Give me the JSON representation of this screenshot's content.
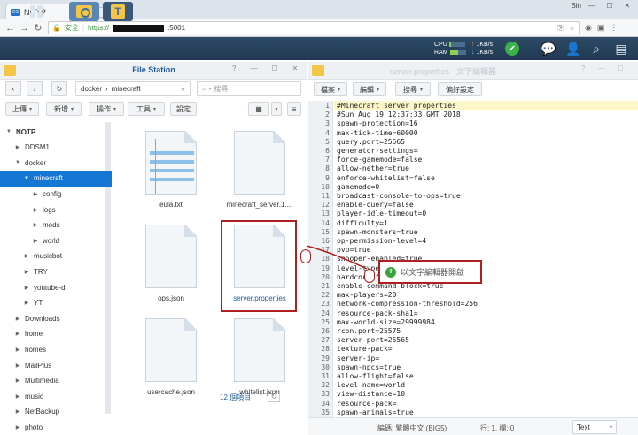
{
  "browser": {
    "tab_title": "NOTP",
    "tab_favicon": "synology-favicon",
    "url_secure_label": "安全",
    "url_prefix": "https://",
    "url_suffix": ":5001",
    "user_corner": "Bin"
  },
  "dsm": {
    "cpu_label": "CPU",
    "ram_label": "RAM",
    "cpu_fraction": 0.15,
    "ram_fraction": 0.5,
    "net_up": "1KB/s",
    "net_down": "1KB/s",
    "net_up_arrow": "↑",
    "net_down_arrow": "↓"
  },
  "filestation": {
    "title": "File Station",
    "path_root": "docker",
    "path_sep": "›",
    "path_leaf": "minecraft",
    "search_placeholder": "搜尋",
    "toolbar": {
      "upload": "上傳",
      "new": "新增",
      "action": "操作",
      "tools": "工具",
      "settings": "設定"
    },
    "tree": [
      {
        "label": "NOTP",
        "arrow": "▼",
        "level": 0,
        "bold": true
      },
      {
        "label": "DDSM1",
        "arrow": "▶",
        "level": 1
      },
      {
        "label": "docker",
        "arrow": "▼",
        "level": 1
      },
      {
        "label": "minecraft",
        "arrow": "▼",
        "level": 2,
        "selected": true
      },
      {
        "label": "config",
        "arrow": "▶",
        "level": 3
      },
      {
        "label": "logs",
        "arrow": "▶",
        "level": 3
      },
      {
        "label": "mods",
        "arrow": "▶",
        "level": 3
      },
      {
        "label": "world",
        "arrow": "▶",
        "level": 3
      },
      {
        "label": "musicbot",
        "arrow": "▶",
        "level": 2
      },
      {
        "label": "TRY",
        "arrow": "▶",
        "level": 2
      },
      {
        "label": "youtube-dl",
        "arrow": "▶",
        "level": 2
      },
      {
        "label": "YT",
        "arrow": "▶",
        "level": 2
      },
      {
        "label": "Downloads",
        "arrow": "▶",
        "level": 1
      },
      {
        "label": "home",
        "arrow": "▶",
        "level": 1
      },
      {
        "label": "homes",
        "arrow": "▶",
        "level": 1
      },
      {
        "label": "MailPlus",
        "arrow": "▶",
        "level": 1
      },
      {
        "label": "Multimedia",
        "arrow": "▶",
        "level": 1
      },
      {
        "label": "music",
        "arrow": "▶",
        "level": 1
      },
      {
        "label": "NetBackup",
        "arrow": "▶",
        "level": 1
      },
      {
        "label": "photo",
        "arrow": "▶",
        "level": 1
      }
    ],
    "files": [
      {
        "name": "eula.txt",
        "lined": true
      },
      {
        "name": "minecraft_server.1....",
        "lined": false
      },
      {
        "name": "ops.json",
        "lined": false
      },
      {
        "name": "server.properties",
        "lined": false,
        "selected": true
      },
      {
        "name": "usercache.json",
        "lined": false
      },
      {
        "name": "whitelist.json",
        "lined": false
      }
    ],
    "item_count": "12 個項目"
  },
  "editor": {
    "title": "server.properties - 文字編輯器",
    "menus": {
      "file": "檔案",
      "edit": "編輯",
      "search": "搜尋",
      "prefs": "偏好設定"
    },
    "lines": [
      "#Minecraft server properties",
      "#Sun Aug 19 12:37:33 GMT 2018",
      "spawn-protection=16",
      "max-tick-time=60000",
      "query.port=25565",
      "generator-settings=",
      "force-gamemode=false",
      "allow-nether=true",
      "enforce-whitelist=false",
      "gamemode=0",
      "broadcast-console-to-ops=true",
      "enable-query=false",
      "player-idle-timeout=0",
      "difficulty=1",
      "spawn-monsters=true",
      "op-permission-level=4",
      "pvp=true",
      "snooper-enabled=true",
      "level-type=DEFAULT",
      "hardcore=false",
      "enable-command-block=true",
      "max-players=20",
      "network-compression-threshold=256",
      "resource-pack-sha1=",
      "max-world-size=29999984",
      "rcon.port=25575",
      "server-port=25565",
      "texture-pack=",
      "server-ip=",
      "spawn-npcs=true",
      "allow-flight=false",
      "level-name=world",
      "view-distance=10",
      "resource-pack=",
      "spawn-animals=true"
    ],
    "encoding": "編碼: 繁體中文 (BIG5)",
    "cursor": "行: 1, 欄: 0",
    "mode": "Text"
  },
  "drag_tooltip": {
    "label": "以文字編輯器開啟"
  },
  "colors": {
    "accent": "#1477d4",
    "highlight_box": "#b01e1e",
    "ok_green": "#3cb04a"
  }
}
